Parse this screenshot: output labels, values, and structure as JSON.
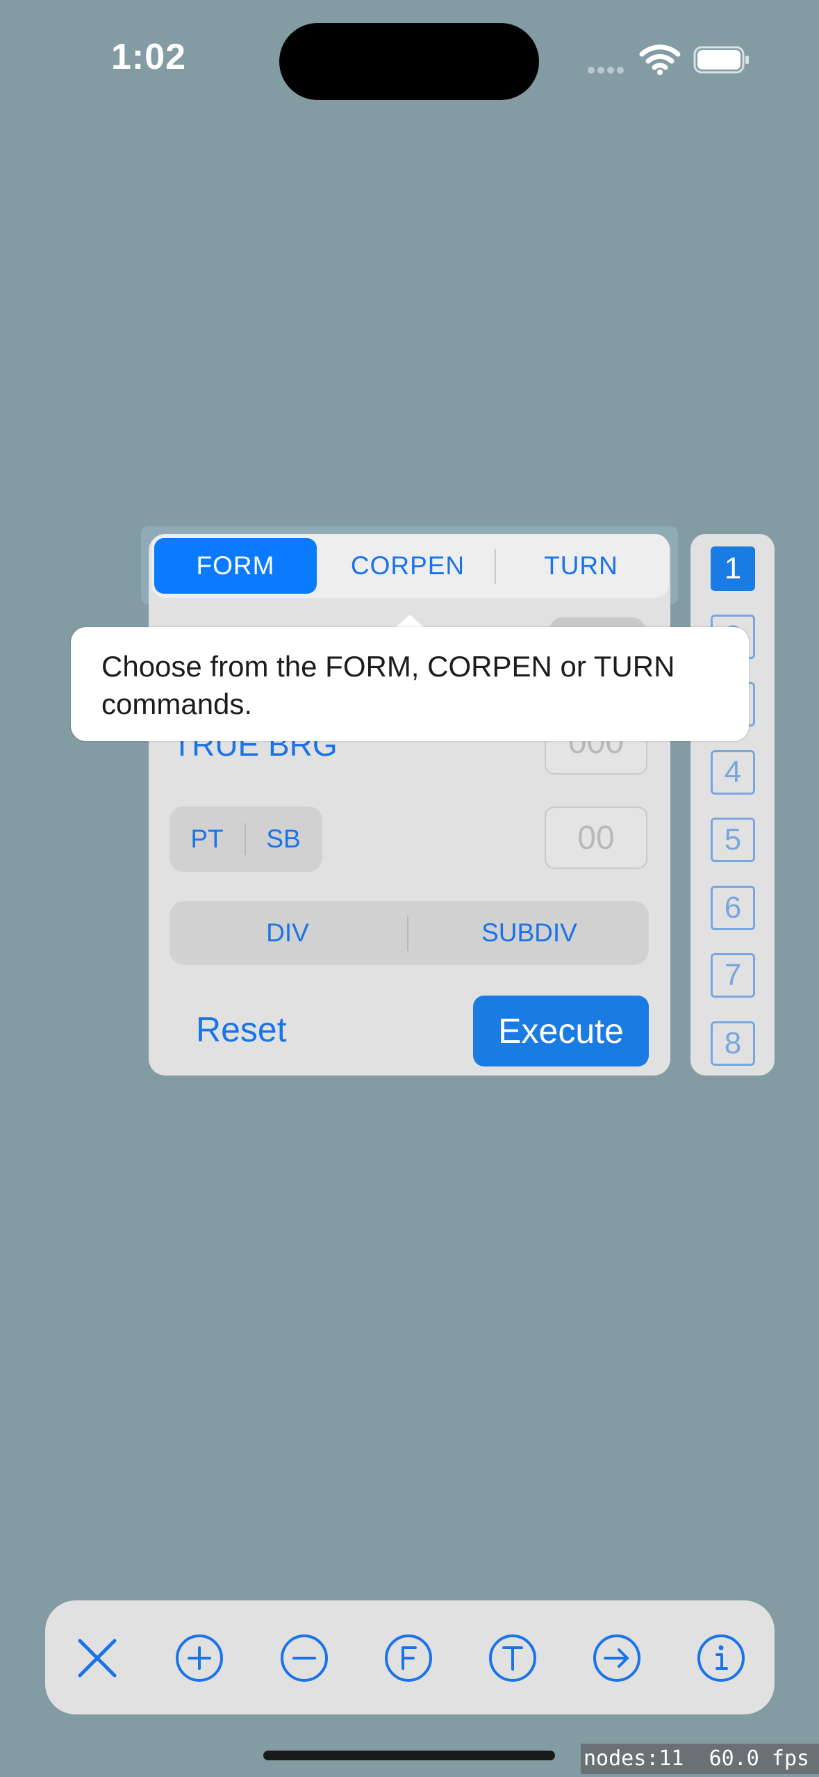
{
  "status_bar": {
    "time": "1:02"
  },
  "tabs": [
    {
      "label": "FORM",
      "selected": true
    },
    {
      "label": "CORPEN",
      "selected": false
    },
    {
      "label": "TURN",
      "selected": false
    }
  ],
  "tooltip": {
    "text": "Choose from the FORM, CORPEN or TURN commands."
  },
  "form": {
    "true_brg_label": "TRUE BRG",
    "true_brg_value": "000",
    "side_options": [
      "PT",
      "SB"
    ],
    "number_value": "00",
    "division_options": [
      "DIV",
      "SUBDIV"
    ],
    "reset_label": "Reset",
    "execute_label": "Execute"
  },
  "number_buttons": [
    "1",
    "2",
    "3",
    "4",
    "5",
    "6",
    "7",
    "8"
  ],
  "selected_number": "1",
  "toolbar_icons": [
    "close-icon",
    "plus-circle-icon",
    "minus-circle-icon",
    "f-circle-icon",
    "t-circle-icon",
    "arrow-right-circle-icon",
    "info-circle-icon"
  ],
  "debug": {
    "text": "nodes:11  60.0 fps"
  },
  "colors": {
    "background": "#839ca3",
    "accent": "#1a73e8",
    "selected_tab": "#0a7bff"
  }
}
